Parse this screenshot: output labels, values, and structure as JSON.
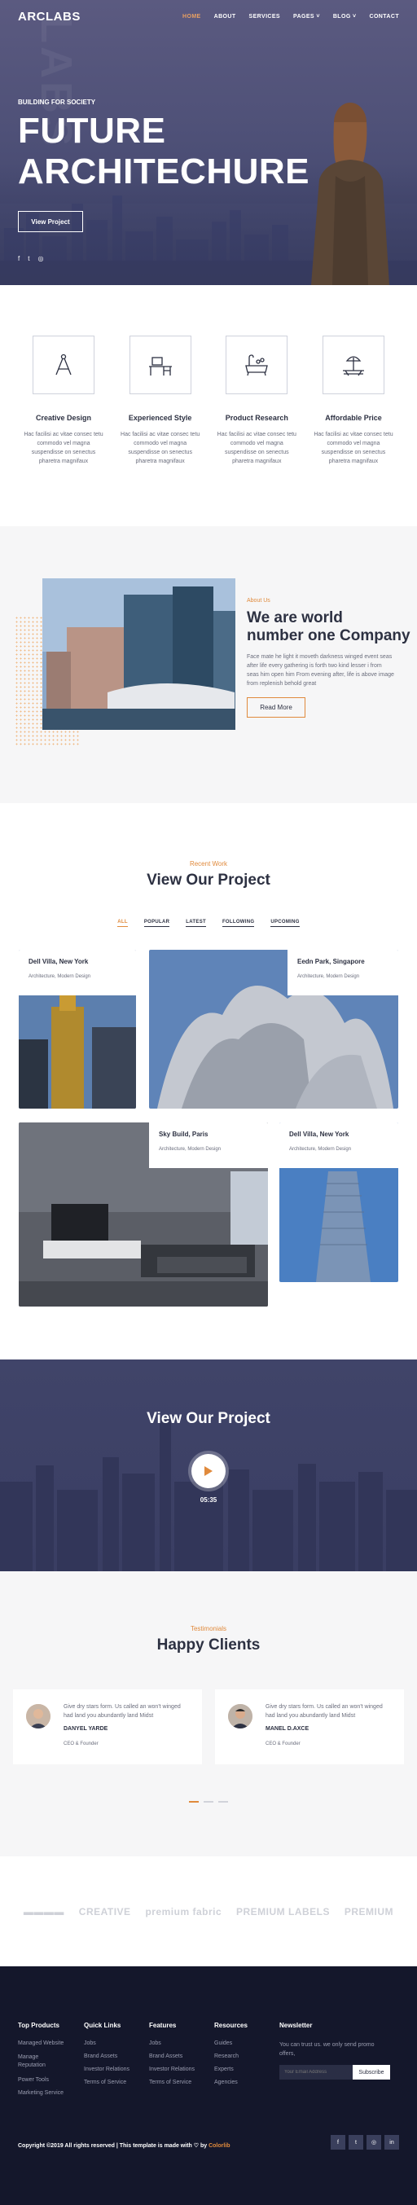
{
  "nav": {
    "logo": "ARCLABS",
    "items": [
      {
        "label": "HOME"
      },
      {
        "label": "ABOUT"
      },
      {
        "label": "SERVICES"
      },
      {
        "label": "PAGES ˅"
      },
      {
        "label": "BLOG ˅"
      },
      {
        "label": "CONTACT"
      }
    ]
  },
  "hero": {
    "bg_word": "LABS",
    "kicker": "BUILDING FOR SOCIETY",
    "title_line1": "FUTURE",
    "title_line2": "ARCHITECHURE",
    "cta": "View Project",
    "social": [
      "f",
      "t",
      "◎"
    ]
  },
  "features": [
    {
      "title": "Creative Design",
      "text": "Hac facilisi ac vitae consec tetu commodo vel magna suspendisse on senectus pharetra magnifaux",
      "icon": "compass-icon"
    },
    {
      "title": "Experienced Style",
      "text": "Hac facilisi ac vitae consec tetu commodo vel magna suspendisse on senectus pharetra magnifaux",
      "icon": "desk-icon"
    },
    {
      "title": "Product Research",
      "text": "Hac facilisi ac vitae consec tetu commodo vel magna suspendisse on senectus pharetra magnifaux",
      "icon": "bathtub-icon"
    },
    {
      "title": "Affordable Price",
      "text": "Hac facilisi ac vitae consec tetu commodo vel magna suspendisse on senectus pharetra magnifaux",
      "icon": "sunbed-icon"
    }
  ],
  "about": {
    "kicker": "About Us",
    "title_line1": "We are world",
    "title_line2": "number one Company",
    "text": "Face mate he light it moveth darkness winged event seas after life every gathering is forth two kind lesser i from seas him open him From evening after, life is above image from replenish behold great",
    "button": "Read More"
  },
  "projects": {
    "kicker": "Recent Work",
    "title": "View Our Project",
    "filters": [
      "ALL",
      "POPULAR",
      "LATEST",
      "FOLLOWING",
      "UPCOMING"
    ],
    "cards": [
      {
        "title": "Dell Villa, New York",
        "sub": "Architecture, Modern Design"
      },
      {
        "title": "Eedn Park, Singapore",
        "sub": "Architecture, Modern Design"
      },
      {
        "title": "Sky Build, Paris",
        "sub": "Architecture, Modern Design"
      },
      {
        "title": "Dell Villa, New York",
        "sub": "Architecture, Modern Design"
      }
    ]
  },
  "video": {
    "title": "View Our Project",
    "time": "05:35"
  },
  "testimonials": {
    "kicker": "Testimonials",
    "title": "Happy Clients",
    "items": [
      {
        "text": "Give dry stars form. Us called an won't winged had land you abundantly land Midst",
        "name": "DANYEL YARDE",
        "role": "CEO & Founder"
      },
      {
        "text": "Give dry stars form. Us called an won't winged had land you abundantly land Midst",
        "name": "MANEL D.AXCE",
        "role": "CEO & Founder"
      }
    ]
  },
  "brands": [
    "▬▬▬▬",
    "CREATIVE",
    "premium fabric",
    "PREMIUM LABELS",
    "PREMIUM"
  ],
  "footer": {
    "cols": [
      {
        "title": "Top Products",
        "links": [
          "Managed Website",
          "Manage Reputation",
          "Power Tools",
          "Marketing Service"
        ]
      },
      {
        "title": "Quick Links",
        "links": [
          "Jobs",
          "Brand Assets",
          "Investor Relations",
          "Terms of Service"
        ]
      },
      {
        "title": "Features",
        "links": [
          "Jobs",
          "Brand Assets",
          "Investor Relations",
          "Terms of Service"
        ]
      },
      {
        "title": "Resources",
        "links": [
          "Guides",
          "Research",
          "Experts",
          "Agencies"
        ]
      }
    ],
    "newsletter": {
      "title": "Newsletter",
      "text": "You can trust us. we only send promo offers,",
      "placeholder": "Your Email Address",
      "button": "Subscribe"
    },
    "copyright_pre": "Copyright ©2019 All rights reserved | This template is made with ♡ by ",
    "copyright_brand": "Colorlib",
    "social": [
      "f",
      "t",
      "◎",
      "in"
    ]
  }
}
